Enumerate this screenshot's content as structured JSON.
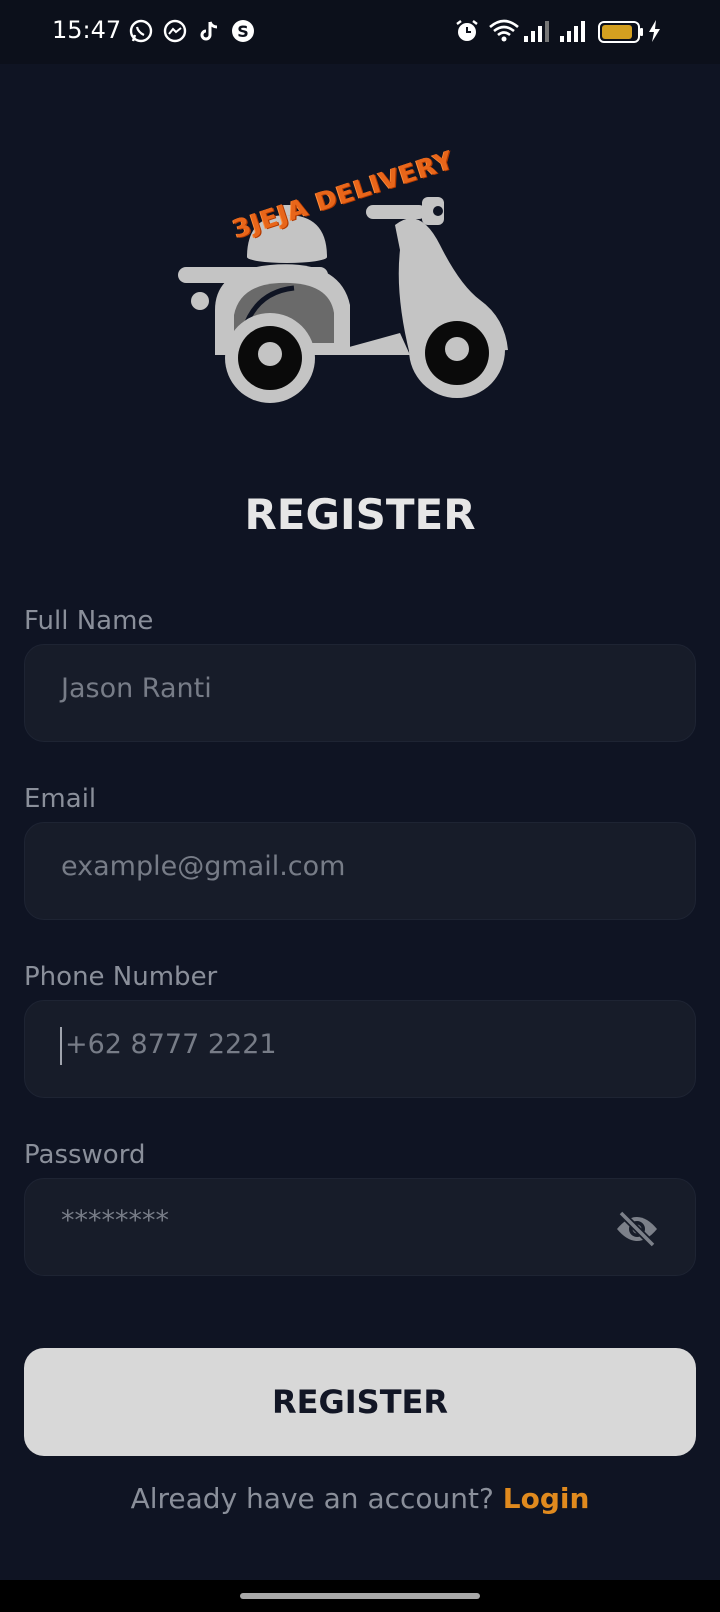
{
  "status_bar": {
    "time": "15:47",
    "left_icons": [
      "whatsapp-icon",
      "messenger-icon",
      "tiktok-icon",
      "s-app-icon"
    ],
    "right_icons": [
      "alarm-icon",
      "wifi-icon",
      "signal-icon",
      "signal-icon",
      "battery-icon",
      "charging-icon"
    ]
  },
  "logo": {
    "text": "3JEJA DELIVERY",
    "colors": {
      "text": "#e8661a",
      "scooter": "#c4c4c4"
    }
  },
  "form": {
    "title": "REGISTER",
    "fields": [
      {
        "label": "Full Name",
        "value": "Jason Ranti"
      },
      {
        "label": "Email",
        "value": "example@gmail.com"
      },
      {
        "label": "Phone Number",
        "value": "+62 8777 2221"
      },
      {
        "label": "Password",
        "value": "********"
      }
    ],
    "submit_label": "REGISTER"
  },
  "footer": {
    "prompt": "Already have an account?",
    "link": "Login"
  },
  "colors": {
    "background": "#0f1423",
    "field_bg": "#171c29",
    "button_bg": "#d8d8d8",
    "accent": "#e08a1e"
  }
}
